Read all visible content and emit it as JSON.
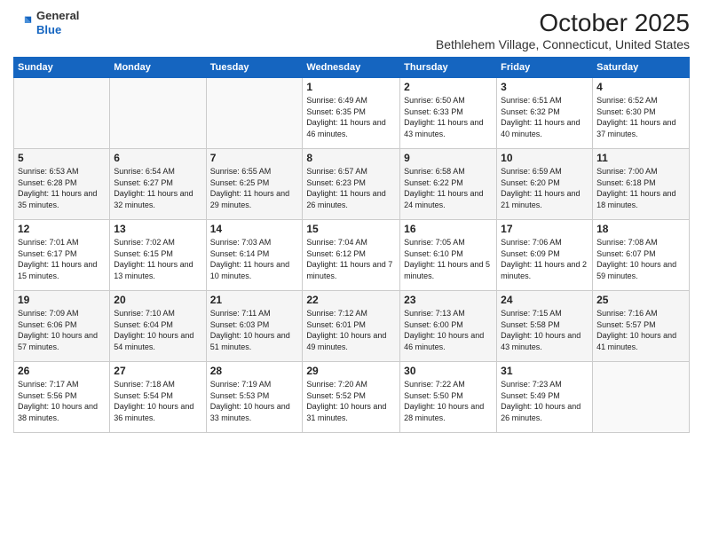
{
  "logo": {
    "general": "General",
    "blue": "Blue"
  },
  "title": "October 2025",
  "location": "Bethlehem Village, Connecticut, United States",
  "days_of_week": [
    "Sunday",
    "Monday",
    "Tuesday",
    "Wednesday",
    "Thursday",
    "Friday",
    "Saturday"
  ],
  "weeks": [
    [
      {
        "day": "",
        "info": ""
      },
      {
        "day": "",
        "info": ""
      },
      {
        "day": "",
        "info": ""
      },
      {
        "day": "1",
        "info": "Sunrise: 6:49 AM\nSunset: 6:35 PM\nDaylight: 11 hours and 46 minutes."
      },
      {
        "day": "2",
        "info": "Sunrise: 6:50 AM\nSunset: 6:33 PM\nDaylight: 11 hours and 43 minutes."
      },
      {
        "day": "3",
        "info": "Sunrise: 6:51 AM\nSunset: 6:32 PM\nDaylight: 11 hours and 40 minutes."
      },
      {
        "day": "4",
        "info": "Sunrise: 6:52 AM\nSunset: 6:30 PM\nDaylight: 11 hours and 37 minutes."
      }
    ],
    [
      {
        "day": "5",
        "info": "Sunrise: 6:53 AM\nSunset: 6:28 PM\nDaylight: 11 hours and 35 minutes."
      },
      {
        "day": "6",
        "info": "Sunrise: 6:54 AM\nSunset: 6:27 PM\nDaylight: 11 hours and 32 minutes."
      },
      {
        "day": "7",
        "info": "Sunrise: 6:55 AM\nSunset: 6:25 PM\nDaylight: 11 hours and 29 minutes."
      },
      {
        "day": "8",
        "info": "Sunrise: 6:57 AM\nSunset: 6:23 PM\nDaylight: 11 hours and 26 minutes."
      },
      {
        "day": "9",
        "info": "Sunrise: 6:58 AM\nSunset: 6:22 PM\nDaylight: 11 hours and 24 minutes."
      },
      {
        "day": "10",
        "info": "Sunrise: 6:59 AM\nSunset: 6:20 PM\nDaylight: 11 hours and 21 minutes."
      },
      {
        "day": "11",
        "info": "Sunrise: 7:00 AM\nSunset: 6:18 PM\nDaylight: 11 hours and 18 minutes."
      }
    ],
    [
      {
        "day": "12",
        "info": "Sunrise: 7:01 AM\nSunset: 6:17 PM\nDaylight: 11 hours and 15 minutes."
      },
      {
        "day": "13",
        "info": "Sunrise: 7:02 AM\nSunset: 6:15 PM\nDaylight: 11 hours and 13 minutes."
      },
      {
        "day": "14",
        "info": "Sunrise: 7:03 AM\nSunset: 6:14 PM\nDaylight: 11 hours and 10 minutes."
      },
      {
        "day": "15",
        "info": "Sunrise: 7:04 AM\nSunset: 6:12 PM\nDaylight: 11 hours and 7 minutes."
      },
      {
        "day": "16",
        "info": "Sunrise: 7:05 AM\nSunset: 6:10 PM\nDaylight: 11 hours and 5 minutes."
      },
      {
        "day": "17",
        "info": "Sunrise: 7:06 AM\nSunset: 6:09 PM\nDaylight: 11 hours and 2 minutes."
      },
      {
        "day": "18",
        "info": "Sunrise: 7:08 AM\nSunset: 6:07 PM\nDaylight: 10 hours and 59 minutes."
      }
    ],
    [
      {
        "day": "19",
        "info": "Sunrise: 7:09 AM\nSunset: 6:06 PM\nDaylight: 10 hours and 57 minutes."
      },
      {
        "day": "20",
        "info": "Sunrise: 7:10 AM\nSunset: 6:04 PM\nDaylight: 10 hours and 54 minutes."
      },
      {
        "day": "21",
        "info": "Sunrise: 7:11 AM\nSunset: 6:03 PM\nDaylight: 10 hours and 51 minutes."
      },
      {
        "day": "22",
        "info": "Sunrise: 7:12 AM\nSunset: 6:01 PM\nDaylight: 10 hours and 49 minutes."
      },
      {
        "day": "23",
        "info": "Sunrise: 7:13 AM\nSunset: 6:00 PM\nDaylight: 10 hours and 46 minutes."
      },
      {
        "day": "24",
        "info": "Sunrise: 7:15 AM\nSunset: 5:58 PM\nDaylight: 10 hours and 43 minutes."
      },
      {
        "day": "25",
        "info": "Sunrise: 7:16 AM\nSunset: 5:57 PM\nDaylight: 10 hours and 41 minutes."
      }
    ],
    [
      {
        "day": "26",
        "info": "Sunrise: 7:17 AM\nSunset: 5:56 PM\nDaylight: 10 hours and 38 minutes."
      },
      {
        "day": "27",
        "info": "Sunrise: 7:18 AM\nSunset: 5:54 PM\nDaylight: 10 hours and 36 minutes."
      },
      {
        "day": "28",
        "info": "Sunrise: 7:19 AM\nSunset: 5:53 PM\nDaylight: 10 hours and 33 minutes."
      },
      {
        "day": "29",
        "info": "Sunrise: 7:20 AM\nSunset: 5:52 PM\nDaylight: 10 hours and 31 minutes."
      },
      {
        "day": "30",
        "info": "Sunrise: 7:22 AM\nSunset: 5:50 PM\nDaylight: 10 hours and 28 minutes."
      },
      {
        "day": "31",
        "info": "Sunrise: 7:23 AM\nSunset: 5:49 PM\nDaylight: 10 hours and 26 minutes."
      },
      {
        "day": "",
        "info": ""
      }
    ]
  ]
}
